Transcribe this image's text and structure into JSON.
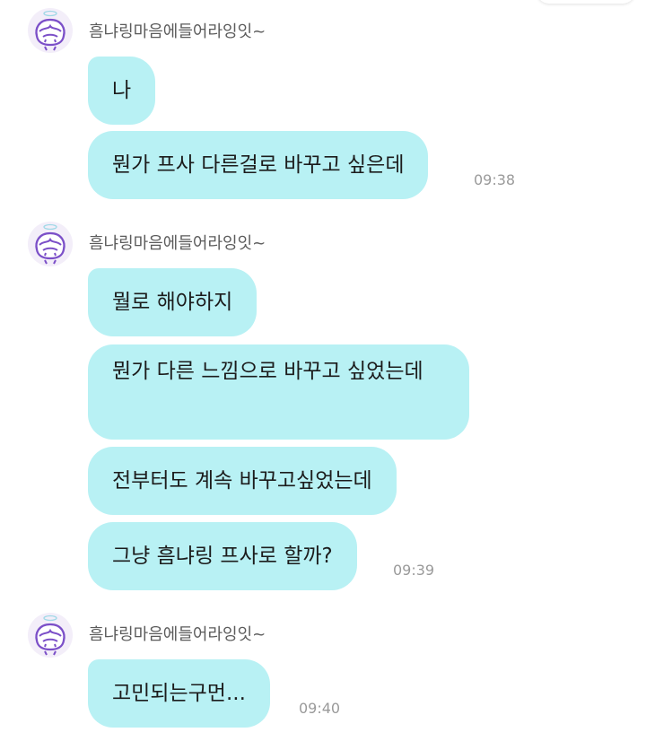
{
  "top_fragment": {},
  "messages": [
    {
      "sender": "흠냐링마음에들어라잉잇~",
      "bubbles": [
        "나",
        "뭔가 프사 다른걸로 바꾸고 싶은데"
      ],
      "time": "09:38"
    },
    {
      "sender": "흠냐링마음에들어라잉잇~",
      "bubbles": [
        "뭘로 해야하지",
        "뭔가 다른 느낌으로 바꾸고 싶었는데",
        "전부터도 계속 바꾸고싶었는데",
        "그냥 흠냐링 프사로 할까?"
      ],
      "time": "09:39"
    },
    {
      "sender": "흠냐링마음에들어라잉잇~",
      "bubbles": [
        "고민되는구먼..."
      ],
      "time": "09:40"
    }
  ],
  "colors": {
    "bubble": "#b8f1f4",
    "time": "#9a9a9a",
    "sender": "#5b5b5b",
    "avatar_outline": "#7b4fc8"
  },
  "icons": {
    "avatar": "cartoon-character-avatar-icon"
  }
}
